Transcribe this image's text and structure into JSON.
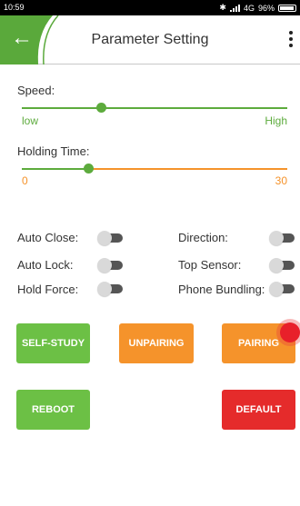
{
  "status_bar": {
    "time": "10:59",
    "bluetooth_icon": "bluetooth-icon",
    "network": "4G",
    "battery": "96%"
  },
  "header": {
    "title": "Parameter Setting",
    "back_icon": "back-arrow-icon",
    "menu_icon": "more-vertical-icon"
  },
  "speed": {
    "label": "Speed:",
    "min_label": "low",
    "max_label": "High",
    "value_fraction": 0.3
  },
  "holding_time": {
    "label": "Holding Time:",
    "min_label": "0",
    "max_label": "30",
    "value_fraction": 0.25
  },
  "toggles": {
    "auto_close": {
      "label": "Auto Close:",
      "on": false
    },
    "auto_lock": {
      "label": "Auto Lock:",
      "on": false
    },
    "hold_force": {
      "label": "Hold Force:",
      "on": false
    },
    "direction": {
      "label": "Direction:",
      "on": false
    },
    "top_sensor": {
      "label": "Top Sensor:",
      "on": false
    },
    "phone_bundling": {
      "label": "Phone Bundling:",
      "on": false
    }
  },
  "buttons": {
    "self_study": "SELF-STUDY",
    "unpairing": "UNPAIRING",
    "pairing": "PAIRING",
    "reboot": "REBOOT",
    "default": "DEFAULT"
  },
  "colors": {
    "green": "#6cc045",
    "orange": "#f5932b",
    "red": "#e52b2b",
    "slider_green": "#5dab3d",
    "slider_orange": "#f5932b"
  }
}
